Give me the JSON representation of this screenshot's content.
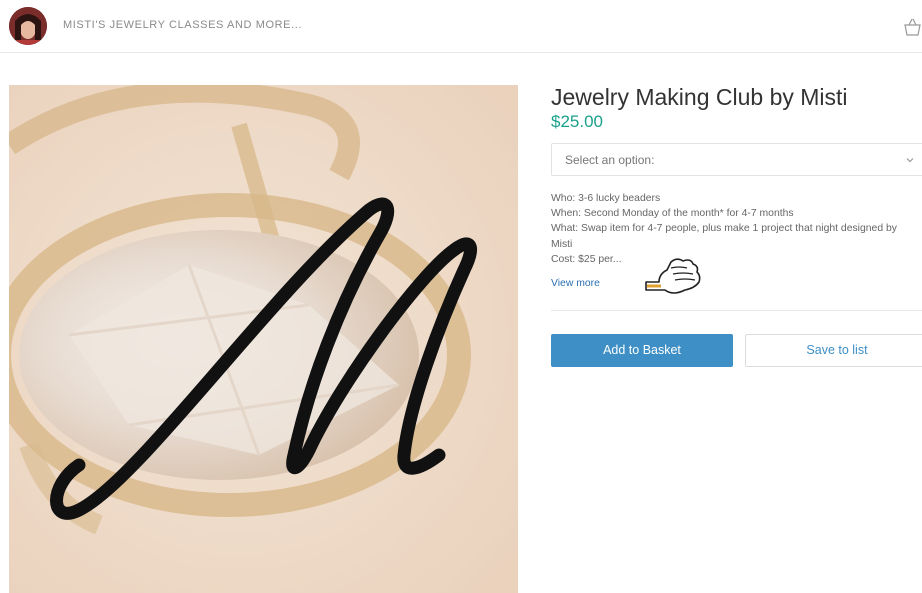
{
  "header": {
    "store_name": "MISTI'S JEWELRY CLASSES AND MORE...",
    "avatar_icon": "avatar-photo",
    "basket_icon": "basket-icon"
  },
  "product": {
    "title": "Jewelry Making Club by Misti",
    "price": "$25.00",
    "price_color": "#1aa08b",
    "option_select": {
      "selected": "Select an option:"
    },
    "description_lines": [
      "Who: 3-6 lucky beaders",
      "When: Second Monday of the month* for 4-7 months",
      "What: Swap item for 4-7 people, plus make 1 project that night designed by",
      "Misti",
      "Cost: $25 per..."
    ],
    "view_more_label": "View more",
    "image": {
      "logo_letter": "M",
      "description_icon": "pointing-hand-icon"
    }
  },
  "actions": {
    "add_to_basket_label": "Add to Basket",
    "save_to_list_label": "Save to list",
    "accent_color": "#3d8fc6"
  }
}
